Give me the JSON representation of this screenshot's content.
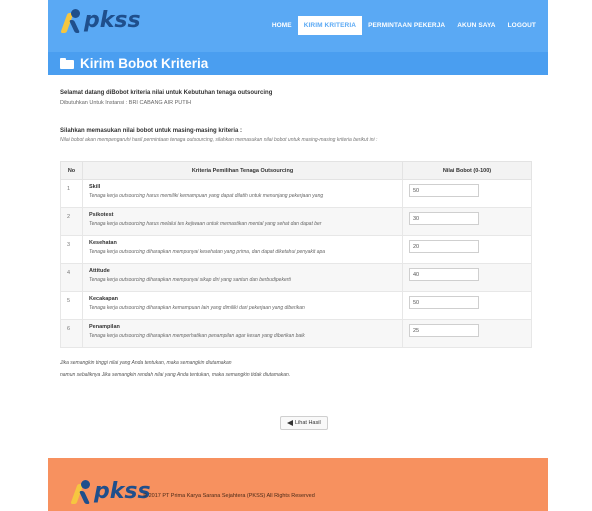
{
  "header": {
    "logo_text": "pkss",
    "nav": [
      {
        "label": "HOME",
        "active": false
      },
      {
        "label": "KIRIM KRITERIA",
        "active": true
      },
      {
        "label": "PERMINTAAN PEKERJA",
        "active": false
      },
      {
        "label": "AKUN SAYA",
        "active": false
      },
      {
        "label": "LOGOUT",
        "active": false
      }
    ]
  },
  "title": {
    "icon": "folder-open-icon",
    "text": "Kirim Bobot Kriteria"
  },
  "intro": {
    "welcome": "Selamat datang diBobot kriteria nilai untuk Kebutuhan tenaga outsourcing",
    "instansi": "Dibutuhkan Untuk Instansi : BRI CABANG AIR PUTIH",
    "instr_title": "Silahkan memasukan nilai bobot untuk masing-masing kriteria :",
    "instr_sub": "Nilai bobot akan mempengaruhi hasil permintaan tenaga outsourcing, silahkan memasukan nilai bobot untuk masing-masing kriteria berikut ini :"
  },
  "table": {
    "headers": [
      "No",
      "Kriteria Pemilihan Tenaga Outsourcing",
      "Nilai Bobot (0-100)"
    ],
    "rows": [
      {
        "no": "1",
        "name": "Skill",
        "desc": "Tenaga kerja outsourcing harus memiliki kemampuan yang dapat dilatih untuk menunjang pekerjaan yang",
        "value": "50"
      },
      {
        "no": "2",
        "name": "Psikotest",
        "desc": "Tenaga kerja outsourcing harus melalui tes kejiwaan untuk memastikan mental yang sehat dan dapat ber",
        "value": "30"
      },
      {
        "no": "3",
        "name": "Kesehatan",
        "desc": "Tenaga kerja outsourcing diharapkan mempunyai kesehatan yang prima, dan dapat diketahui penyakit apa",
        "value": "20"
      },
      {
        "no": "4",
        "name": "Attitude",
        "desc": "Tenaga kerja outsourcing diharapkan mempunyai sikap diri yang santun dan berbudipekerti",
        "value": "40"
      },
      {
        "no": "5",
        "name": "Kecakapan",
        "desc": "Tenaga kerja outsourcing diharapkan kemampuan lain yang dimiliki dari pekerjaan yang diberikan",
        "value": "50"
      },
      {
        "no": "6",
        "name": "Penampilan",
        "desc": "Tenaga kerja outsourcing diharapkan memperhatikan penampilan agar kesan yang diberikan baik",
        "value": "25"
      }
    ]
  },
  "notes": {
    "line1": "Jika semangkin tinggi nilai yang Anda tentukan, maka semangkin diutamakan",
    "line2": "namun sebaliknya Jika semangkin rendah nilai yang Anda tentukan, maka semangkin tidak diutamakan."
  },
  "button": {
    "label": "Lihat Hasil",
    "icon": "send-icon"
  },
  "footer": {
    "logo_text": "pkss",
    "copyright": "© 2017 PT Prima Karya Sarana Sejahtera (PKSS) All Rights Reserved"
  },
  "colors": {
    "header": "#5aa9f4",
    "titlebar": "#4a9ef0",
    "footer": "#f7915f",
    "logo": "#1f4f8c"
  }
}
